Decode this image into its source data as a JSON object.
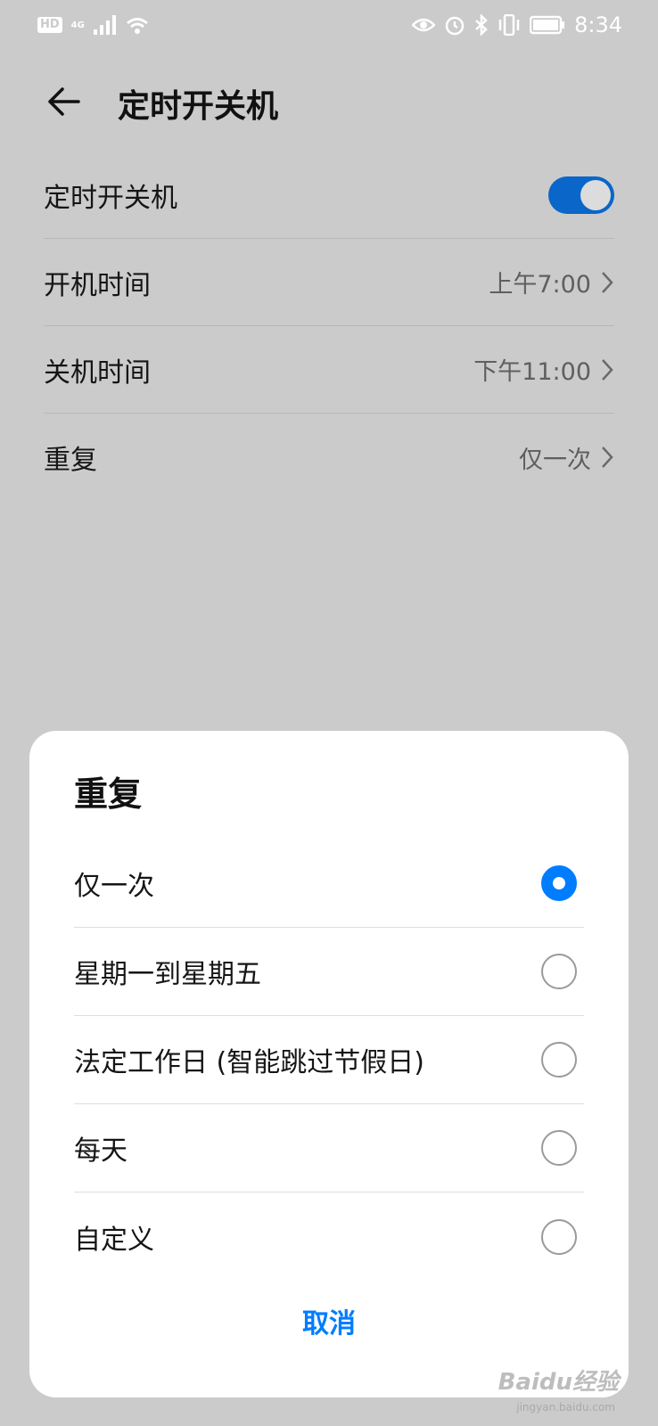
{
  "status_bar": {
    "hd": "HD",
    "network": "4G",
    "time": "8:34",
    "icons": [
      "signal-icon",
      "wifi-icon",
      "eye-icon",
      "alarm-icon",
      "bluetooth-icon",
      "vibrate-icon",
      "battery-icon"
    ]
  },
  "header": {
    "title": "定时开关机"
  },
  "settings": {
    "toggle_label": "定时开关机",
    "toggle_on": true,
    "power_on_label": "开机时间",
    "power_on_value": "上午7:00",
    "power_off_label": "关机时间",
    "power_off_value": "下午11:00",
    "repeat_label": "重复",
    "repeat_value": "仅一次"
  },
  "dialog": {
    "title": "重复",
    "options": [
      {
        "label": "仅一次",
        "selected": true
      },
      {
        "label": "星期一到星期五",
        "selected": false
      },
      {
        "label": "法定工作日 (智能跳过节假日)",
        "selected": false
      },
      {
        "label": "每天",
        "selected": false
      },
      {
        "label": "自定义",
        "selected": false
      }
    ],
    "cancel_label": "取消"
  },
  "watermark": {
    "text": "Baidu经验",
    "sub": "jingyan.baidu.com"
  },
  "colors": {
    "accent": "#007dff",
    "toggle_on": "#0a66c9",
    "background": "#cbcbcb"
  }
}
